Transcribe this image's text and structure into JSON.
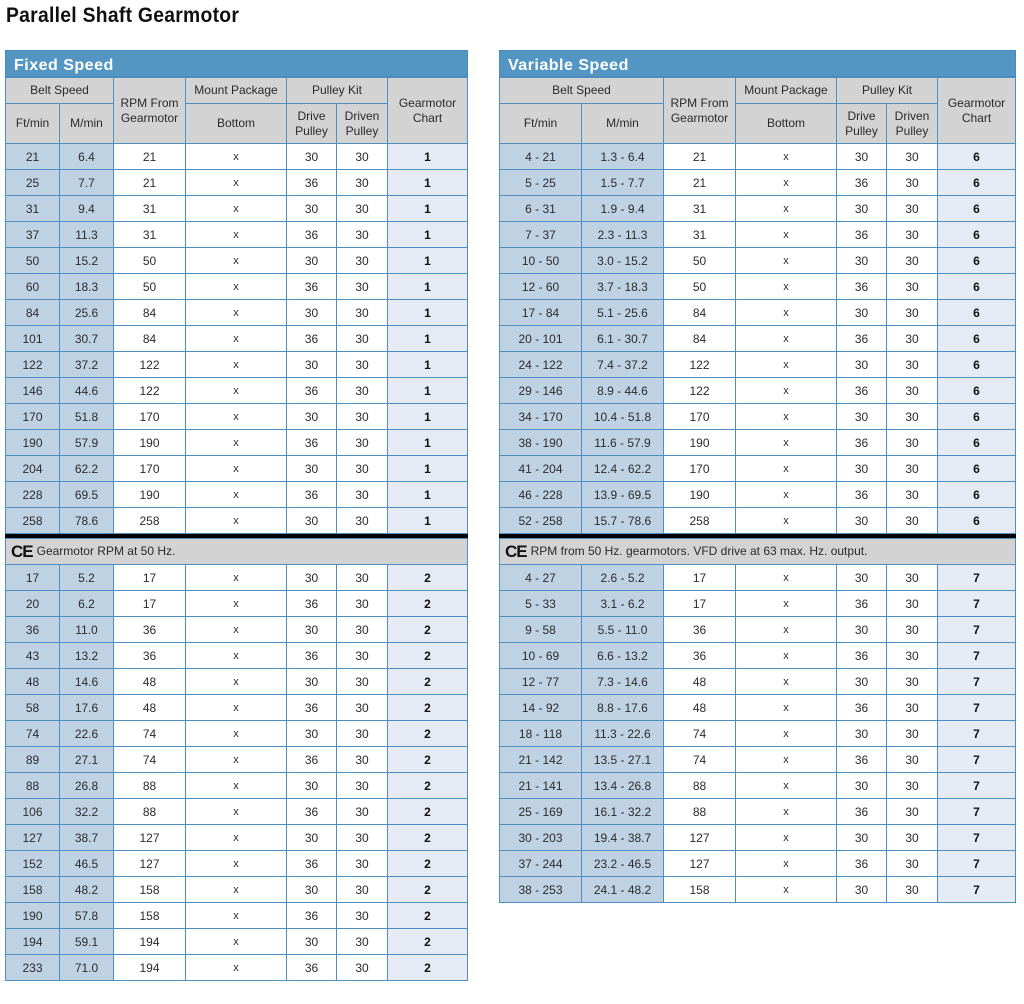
{
  "page_title": "Parallel Shaft Gearmotor",
  "headers": {
    "belt_speed": "Belt Speed",
    "ft_min": "Ft/min",
    "m_min": "M/min",
    "rpm_from": "RPM From Gearmotor",
    "mount_package": "Mount Package",
    "bottom": "Bottom",
    "pulley_kit": "Pulley Kit",
    "drive_pulley": "Drive Pulley",
    "driven_pulley": "Driven Pulley",
    "gearmotor_chart": "Gearmotor Chart"
  },
  "fixed_speed": {
    "title": "Fixed Speed",
    "note": "Gearmotor RPM at 50 Hz.",
    "group1": [
      [
        "21",
        "6.4",
        "21",
        "x",
        "30",
        "30",
        "1"
      ],
      [
        "25",
        "7.7",
        "21",
        "x",
        "36",
        "30",
        "1"
      ],
      [
        "31",
        "9.4",
        "31",
        "x",
        "30",
        "30",
        "1"
      ],
      [
        "37",
        "11.3",
        "31",
        "x",
        "36",
        "30",
        "1"
      ],
      [
        "50",
        "15.2",
        "50",
        "x",
        "30",
        "30",
        "1"
      ],
      [
        "60",
        "18.3",
        "50",
        "x",
        "36",
        "30",
        "1"
      ],
      [
        "84",
        "25.6",
        "84",
        "x",
        "30",
        "30",
        "1"
      ],
      [
        "101",
        "30.7",
        "84",
        "x",
        "36",
        "30",
        "1"
      ],
      [
        "122",
        "37.2",
        "122",
        "x",
        "30",
        "30",
        "1"
      ],
      [
        "146",
        "44.6",
        "122",
        "x",
        "36",
        "30",
        "1"
      ],
      [
        "170",
        "51.8",
        "170",
        "x",
        "30",
        "30",
        "1"
      ],
      [
        "190",
        "57.9",
        "190",
        "x",
        "36",
        "30",
        "1"
      ],
      [
        "204",
        "62.2",
        "170",
        "x",
        "30",
        "30",
        "1"
      ],
      [
        "228",
        "69.5",
        "190",
        "x",
        "36",
        "30",
        "1"
      ],
      [
        "258",
        "78.6",
        "258",
        "x",
        "30",
        "30",
        "1"
      ]
    ],
    "group2": [
      [
        "17",
        "5.2",
        "17",
        "x",
        "30",
        "30",
        "2"
      ],
      [
        "20",
        "6.2",
        "17",
        "x",
        "36",
        "30",
        "2"
      ],
      [
        "36",
        "11.0",
        "36",
        "x",
        "30",
        "30",
        "2"
      ],
      [
        "43",
        "13.2",
        "36",
        "x",
        "36",
        "30",
        "2"
      ],
      [
        "48",
        "14.6",
        "48",
        "x",
        "30",
        "30",
        "2"
      ],
      [
        "58",
        "17.6",
        "48",
        "x",
        "36",
        "30",
        "2"
      ],
      [
        "74",
        "22.6",
        "74",
        "x",
        "30",
        "30",
        "2"
      ],
      [
        "89",
        "27.1",
        "74",
        "x",
        "36",
        "30",
        "2"
      ],
      [
        "88",
        "26.8",
        "88",
        "x",
        "30",
        "30",
        "2"
      ],
      [
        "106",
        "32.2",
        "88",
        "x",
        "36",
        "30",
        "2"
      ],
      [
        "127",
        "38.7",
        "127",
        "x",
        "30",
        "30",
        "2"
      ],
      [
        "152",
        "46.5",
        "127",
        "x",
        "36",
        "30",
        "2"
      ],
      [
        "158",
        "48.2",
        "158",
        "x",
        "30",
        "30",
        "2"
      ],
      [
        "190",
        "57.8",
        "158",
        "x",
        "36",
        "30",
        "2"
      ],
      [
        "194",
        "59.1",
        "194",
        "x",
        "30",
        "30",
        "2"
      ],
      [
        "233",
        "71.0",
        "194",
        "x",
        "36",
        "30",
        "2"
      ]
    ]
  },
  "variable_speed": {
    "title": "Variable Speed",
    "note": "RPM from 50 Hz. gearmotors. VFD drive at 63 max. Hz. output.",
    "group1": [
      [
        "4 - 21",
        "1.3 - 6.4",
        "21",
        "x",
        "30",
        "30",
        "6"
      ],
      [
        "5 - 25",
        "1.5 - 7.7",
        "21",
        "x",
        "36",
        "30",
        "6"
      ],
      [
        "6 - 31",
        "1.9 - 9.4",
        "31",
        "x",
        "30",
        "30",
        "6"
      ],
      [
        "7 - 37",
        "2.3 - 11.3",
        "31",
        "x",
        "36",
        "30",
        "6"
      ],
      [
        "10 - 50",
        "3.0 - 15.2",
        "50",
        "x",
        "30",
        "30",
        "6"
      ],
      [
        "12 - 60",
        "3.7 - 18.3",
        "50",
        "x",
        "36",
        "30",
        "6"
      ],
      [
        "17 - 84",
        "5.1 - 25.6",
        "84",
        "x",
        "30",
        "30",
        "6"
      ],
      [
        "20 - 101",
        "6.1 - 30.7",
        "84",
        "x",
        "36",
        "30",
        "6"
      ],
      [
        "24 - 122",
        "7.4 - 37.2",
        "122",
        "x",
        "30",
        "30",
        "6"
      ],
      [
        "29 - 146",
        "8.9 - 44.6",
        "122",
        "x",
        "36",
        "30",
        "6"
      ],
      [
        "34 - 170",
        "10.4 - 51.8",
        "170",
        "x",
        "30",
        "30",
        "6"
      ],
      [
        "38 - 190",
        "11.6 - 57.9",
        "190",
        "x",
        "36",
        "30",
        "6"
      ],
      [
        "41 - 204",
        "12.4 - 62.2",
        "170",
        "x",
        "30",
        "30",
        "6"
      ],
      [
        "46 - 228",
        "13.9 - 69.5",
        "190",
        "x",
        "36",
        "30",
        "6"
      ],
      [
        "52 - 258",
        "15.7 - 78.6",
        "258",
        "x",
        "30",
        "30",
        "6"
      ]
    ],
    "group2": [
      [
        "4 - 27",
        "2.6 - 5.2",
        "17",
        "x",
        "30",
        "30",
        "7"
      ],
      [
        "5 - 33",
        "3.1 - 6.2",
        "17",
        "x",
        "36",
        "30",
        "7"
      ],
      [
        "9 - 58",
        "5.5 - 11.0",
        "36",
        "x",
        "30",
        "30",
        "7"
      ],
      [
        "10 - 69",
        "6.6 - 13.2",
        "36",
        "x",
        "36",
        "30",
        "7"
      ],
      [
        "12 - 77",
        "7.3 - 14.6",
        "48",
        "x",
        "30",
        "30",
        "7"
      ],
      [
        "14 - 92",
        "8.8 - 17.6",
        "48",
        "x",
        "36",
        "30",
        "7"
      ],
      [
        "18 - 118",
        "11.3 - 22.6",
        "74",
        "x",
        "30",
        "30",
        "7"
      ],
      [
        "21 - 142",
        "13.5 - 27.1",
        "74",
        "x",
        "36",
        "30",
        "7"
      ],
      [
        "21 - 141",
        "13.4 - 26.8",
        "88",
        "x",
        "30",
        "30",
        "7"
      ],
      [
        "25 - 169",
        "16.1 - 32.2",
        "88",
        "x",
        "36",
        "30",
        "7"
      ],
      [
        "30 - 203",
        "19.4 - 38.7",
        "127",
        "x",
        "30",
        "30",
        "7"
      ],
      [
        "37 - 244",
        "23.2 - 46.5",
        "127",
        "x",
        "36",
        "30",
        "7"
      ],
      [
        "38 - 253",
        "24.1 - 48.2",
        "158",
        "x",
        "30",
        "30",
        "7"
      ]
    ]
  },
  "ce_mark": "CE",
  "colors": {
    "title_bar": "#5496c3",
    "header_bg": "#d3d3d3",
    "speed_col_bg": "#bfd2e4",
    "chart_col_bg": "#e6eaf4",
    "grid_line": "#4d8fc0"
  }
}
